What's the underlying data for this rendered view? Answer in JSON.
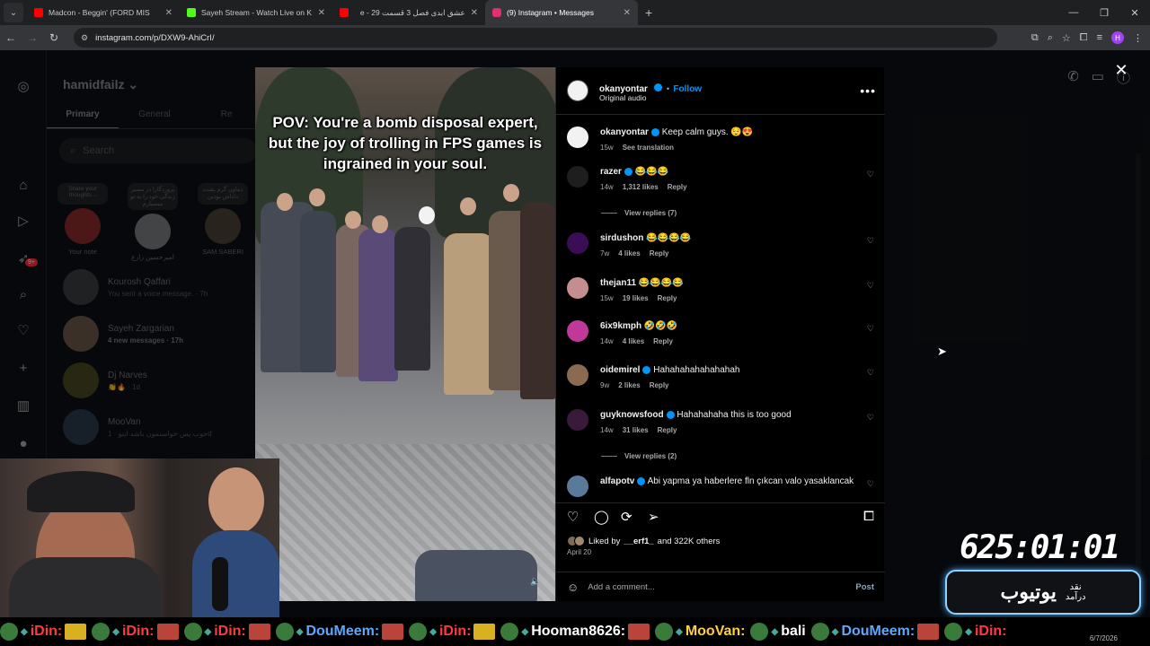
{
  "browser": {
    "tabs": [
      {
        "title": "Madcon - Beggin' (FORD MIS",
        "favicon_color": "#ff0000",
        "active": false
      },
      {
        "title": "Sayeh Stream - Watch Live on K",
        "favicon_color": "#53fc18",
        "active": false
      },
      {
        "title": "عشق ابدی فصل 3 قسمت 29 - e",
        "favicon_color": "#ff0000",
        "active": false
      },
      {
        "title": "(9) Instagram • Messages",
        "favicon_color": "#e1306c",
        "active": true
      }
    ],
    "url": "instagram.com/p/DXW9-AhiCrI/"
  },
  "dm": {
    "username": "hamidfailz",
    "tabs": [
      "Primary",
      "General",
      "Re"
    ],
    "search_placeholder": "Search",
    "badge": "9+",
    "notes": [
      {
        "bubble": "Share your thoughts...",
        "name": "Your note"
      },
      {
        "bubble": "پروردگارا در مسیر زندگی خود را به تو میسپارم",
        "name": "امیرحسین زارع"
      },
      {
        "bubble": "دماون گرم پشت داداش بودین",
        "name": "SAM SABERI"
      }
    ],
    "conversations": [
      {
        "name": "Kourosh Qaffari",
        "message": "You sent a voice message. · 7h",
        "new": false
      },
      {
        "name": "Sayeh Zargarian",
        "message": "4 new messages · 17h",
        "new": true
      },
      {
        "name": "Dj Narves",
        "message": "👏🔥 · 1d",
        "new": false
      },
      {
        "name": "MooVan",
        "message": "خوب پس خواستمون باشه ابنو · 1d",
        "new": false
      }
    ]
  },
  "video": {
    "caption": "POV: You're a bomb disposal expert, but the joy of trolling in FPS games is ingrained in your soul."
  },
  "post": {
    "author": "okanyontar",
    "follow_label": "Follow",
    "separator": "•",
    "audio": "Original audio",
    "more_label": "•••",
    "caption": {
      "user": "okanyontar",
      "text": "Keep calm guys. 😌😍",
      "age": "15w",
      "action": "See translation"
    },
    "comments": [
      {
        "user": "razer",
        "verified": true,
        "text": "😂😂😂",
        "age": "14w",
        "likes": "1,312 likes",
        "reply": "Reply",
        "view_replies": "View replies (7)",
        "avatar_color": "#1e1e1e"
      },
      {
        "user": "sirdushon",
        "verified": false,
        "text": "😂😂😂😂",
        "age": "7w",
        "likes": "4 likes",
        "reply": "Reply",
        "view_replies": "",
        "avatar_color": "#3a0d55"
      },
      {
        "user": "thejan11",
        "verified": false,
        "text": "😂😂😂😂",
        "age": "15w",
        "likes": "19 likes",
        "reply": "Reply",
        "view_replies": "",
        "avatar_color": "#c58e8e"
      },
      {
        "user": "6ix9kmph",
        "verified": false,
        "text": "🤣🤣🤣",
        "age": "14w",
        "likes": "4 likes",
        "reply": "Reply",
        "view_replies": "",
        "avatar_color": "#c0399a"
      },
      {
        "user": "oidemirel",
        "verified": true,
        "text": "Hahahahahahahahah",
        "age": "9w",
        "likes": "2 likes",
        "reply": "Reply",
        "view_replies": "",
        "avatar_color": "#8a6b52"
      },
      {
        "user": "guyknowsfood",
        "verified": true,
        "text": "Hahahahaha this is too good",
        "age": "14w",
        "likes": "31 likes",
        "reply": "Reply",
        "view_replies": "View replies (2)",
        "avatar_color": "#3a1a3a"
      },
      {
        "user": "alfapotv",
        "verified": true,
        "text": "Abi yapma ya haberlere fln çıkcan valo yasaklancak",
        "age": "",
        "likes": "",
        "reply": "",
        "view_replies": "",
        "avatar_color": "#5a7a9a"
      }
    ],
    "liked_by_prefix": "Liked by",
    "liked_by_user": "__erf1_",
    "liked_by_suffix": "and 322K others",
    "date": "April 20",
    "add_comment_placeholder": "Add a comment...",
    "post_label": "Post"
  },
  "overlay": {
    "timer": "625:01:01",
    "badge_big": "یوتیوب",
    "badge_small_1": "نقد",
    "badge_small_2": "درآمد",
    "date": "6/7/2026"
  },
  "ticker": [
    {
      "name": "iDin:",
      "color": "#ff3b3b",
      "emote": "y"
    },
    {
      "name": "iDin:",
      "color": "#ff3b3b",
      "emote": "r"
    },
    {
      "name": "iDin:",
      "color": "#ff3b3b",
      "emote": "r"
    },
    {
      "name": "DouMeem:",
      "color": "#5aa8ff",
      "emote": "r"
    },
    {
      "name": "iDin:",
      "color": "#ff3b3b",
      "emote": "y"
    },
    {
      "name": "Hooman8626:",
      "color": "#ffffff",
      "emote": "r"
    },
    {
      "name": "MooVan:",
      "color": "#ffcf3a",
      "emote": ""
    },
    {
      "name": "bali",
      "color": "#ffffff",
      "emote": ""
    },
    {
      "name": "DouMeem:",
      "color": "#5aa8ff",
      "emote": "r"
    },
    {
      "name": "iDin:",
      "color": "#ff3b3b",
      "emote": ""
    }
  ]
}
